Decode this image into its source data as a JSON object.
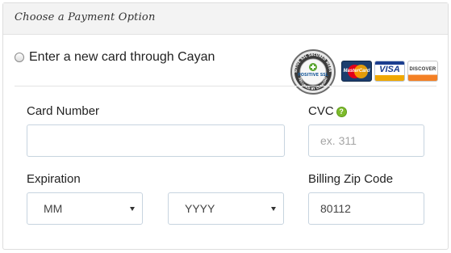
{
  "panel": {
    "title": "Choose a Payment Option"
  },
  "payment_option": {
    "label": "Enter a new card through Cayan",
    "selected": false
  },
  "badges": {
    "ssl_seal_text": "POSITIVE SSL",
    "ssl_ring_top": "POSITIVE SSL SECURED WEBSITE",
    "ssl_ring_bottom": "SECURED BY COMODO",
    "mastercard": "MasterCard",
    "visa": "VISA",
    "discover": "DISCOVER"
  },
  "form": {
    "card_number": {
      "label": "Card Number",
      "value": "",
      "placeholder": ""
    },
    "cvc": {
      "label": "CVC",
      "value": "",
      "placeholder": "ex. 311",
      "help_icon": "question-icon"
    },
    "expiration": {
      "label": "Expiration",
      "month_selected": "MM",
      "year_selected": "YYYY"
    },
    "billing_zip": {
      "label": "Billing Zip Code",
      "value": "80112"
    }
  },
  "colors": {
    "header_bg": "#f3f3f3",
    "input_border": "#c7d4df",
    "help_green": "#7dbb2b"
  }
}
